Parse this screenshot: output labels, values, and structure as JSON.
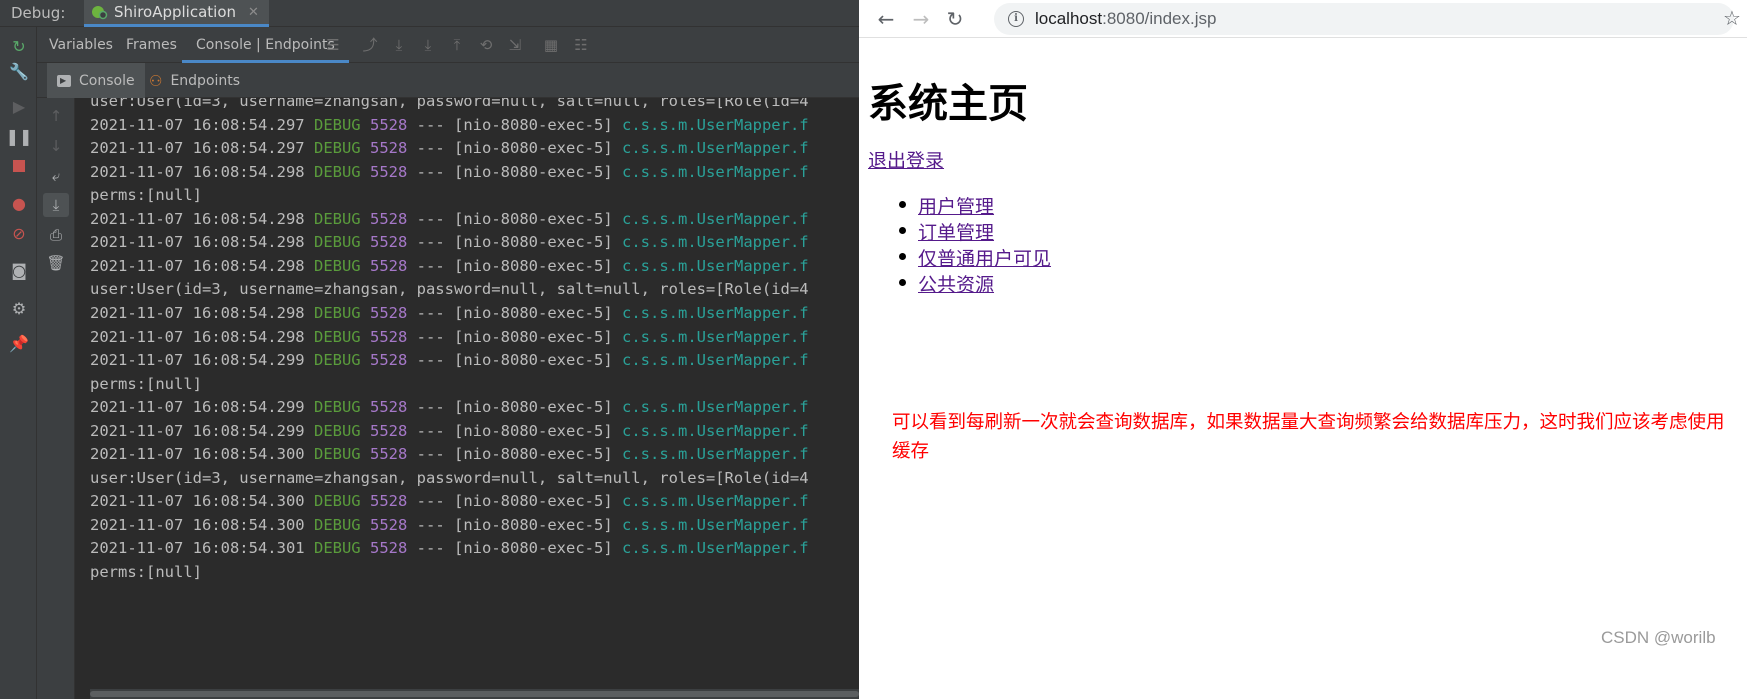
{
  "ide": {
    "debug_label": "Debug:",
    "run_tab": "ShiroApplication",
    "tabs": [
      "Variables",
      "Frames",
      "Console | Endpoints"
    ],
    "subtabs": [
      "Console",
      "Endpoints"
    ],
    "console_lines": [
      {
        "type": "text",
        "text": "user:User(id=3, username=zhangsan, password=null, salt=null, roles=[Role(id=4"
      },
      {
        "type": "log",
        "ts": "2021-11-07 16:08:54.297",
        "level": "DEBUG",
        "pid": "5528",
        "sep": "---",
        "thread": "[nio-8080-exec-5]",
        "cls": "c.s.s.m.UserMapper.f"
      },
      {
        "type": "log",
        "ts": "2021-11-07 16:08:54.297",
        "level": "DEBUG",
        "pid": "5528",
        "sep": "---",
        "thread": "[nio-8080-exec-5]",
        "cls": "c.s.s.m.UserMapper.f"
      },
      {
        "type": "log",
        "ts": "2021-11-07 16:08:54.298",
        "level": "DEBUG",
        "pid": "5528",
        "sep": "---",
        "thread": "[nio-8080-exec-5]",
        "cls": "c.s.s.m.UserMapper.f"
      },
      {
        "type": "text",
        "text": "perms:[null]"
      },
      {
        "type": "log",
        "ts": "2021-11-07 16:08:54.298",
        "level": "DEBUG",
        "pid": "5528",
        "sep": "---",
        "thread": "[nio-8080-exec-5]",
        "cls": "c.s.s.m.UserMapper.f"
      },
      {
        "type": "log",
        "ts": "2021-11-07 16:08:54.298",
        "level": "DEBUG",
        "pid": "5528",
        "sep": "---",
        "thread": "[nio-8080-exec-5]",
        "cls": "c.s.s.m.UserMapper.f"
      },
      {
        "type": "log",
        "ts": "2021-11-07 16:08:54.298",
        "level": "DEBUG",
        "pid": "5528",
        "sep": "---",
        "thread": "[nio-8080-exec-5]",
        "cls": "c.s.s.m.UserMapper.f"
      },
      {
        "type": "text",
        "text": "user:User(id=3, username=zhangsan, password=null, salt=null, roles=[Role(id=4"
      },
      {
        "type": "log",
        "ts": "2021-11-07 16:08:54.298",
        "level": "DEBUG",
        "pid": "5528",
        "sep": "---",
        "thread": "[nio-8080-exec-5]",
        "cls": "c.s.s.m.UserMapper.f"
      },
      {
        "type": "log",
        "ts": "2021-11-07 16:08:54.298",
        "level": "DEBUG",
        "pid": "5528",
        "sep": "---",
        "thread": "[nio-8080-exec-5]",
        "cls": "c.s.s.m.UserMapper.f"
      },
      {
        "type": "log",
        "ts": "2021-11-07 16:08:54.299",
        "level": "DEBUG",
        "pid": "5528",
        "sep": "---",
        "thread": "[nio-8080-exec-5]",
        "cls": "c.s.s.m.UserMapper.f"
      },
      {
        "type": "text",
        "text": "perms:[null]"
      },
      {
        "type": "log",
        "ts": "2021-11-07 16:08:54.299",
        "level": "DEBUG",
        "pid": "5528",
        "sep": "---",
        "thread": "[nio-8080-exec-5]",
        "cls": "c.s.s.m.UserMapper.f"
      },
      {
        "type": "log",
        "ts": "2021-11-07 16:08:54.299",
        "level": "DEBUG",
        "pid": "5528",
        "sep": "---",
        "thread": "[nio-8080-exec-5]",
        "cls": "c.s.s.m.UserMapper.f"
      },
      {
        "type": "log",
        "ts": "2021-11-07 16:08:54.300",
        "level": "DEBUG",
        "pid": "5528",
        "sep": "---",
        "thread": "[nio-8080-exec-5]",
        "cls": "c.s.s.m.UserMapper.f"
      },
      {
        "type": "text",
        "text": "user:User(id=3, username=zhangsan, password=null, salt=null, roles=[Role(id=4"
      },
      {
        "type": "log",
        "ts": "2021-11-07 16:08:54.300",
        "level": "DEBUG",
        "pid": "5528",
        "sep": "---",
        "thread": "[nio-8080-exec-5]",
        "cls": "c.s.s.m.UserMapper.f"
      },
      {
        "type": "log",
        "ts": "2021-11-07 16:08:54.300",
        "level": "DEBUG",
        "pid": "5528",
        "sep": "---",
        "thread": "[nio-8080-exec-5]",
        "cls": "c.s.s.m.UserMapper.f"
      },
      {
        "type": "log",
        "ts": "2021-11-07 16:08:54.301",
        "level": "DEBUG",
        "pid": "5528",
        "sep": "---",
        "thread": "[nio-8080-exec-5]",
        "cls": "c.s.s.m.UserMapper.f"
      },
      {
        "type": "text",
        "text": "perms:[null]"
      }
    ],
    "colors": {
      "level": "#5a9c3c",
      "pid": "#a678c9",
      "cls": "#2aa198",
      "accent": "#4a88c7"
    }
  },
  "browser": {
    "url_host": "localhost",
    "url_rest": ":8080/index.jsp",
    "page": {
      "title": "系统主页",
      "logout": "退出登录",
      "links": [
        "用户管理",
        "订单管理",
        "仅普通用户可见",
        "公共资源"
      ]
    },
    "annotation": "可以看到每刷新一次就会查询数据库，如果数据量大查询频繁会给数据库压力，这时我们应该考虑使用缓存",
    "watermark": "CSDN @worilb"
  }
}
